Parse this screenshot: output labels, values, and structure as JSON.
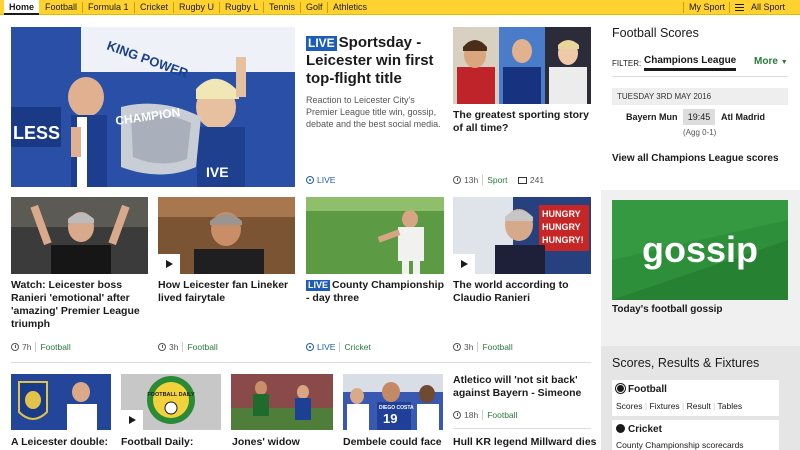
{
  "nav": {
    "items": [
      "Home",
      "Football",
      "Formula 1",
      "Cricket",
      "Rugby U",
      "Rugby L",
      "Tennis",
      "Golf",
      "Athletics"
    ],
    "my_sport": "My Sport",
    "all_sport": "All Sport"
  },
  "hero": {
    "live_badge": "LIVE",
    "title": "Sportsday - Leicester win first top-flight title",
    "summary": "Reaction to Leicester City's Premier League title win, gossip, debate and the best social media.",
    "meta_live": "LIVE"
  },
  "story_greatest": {
    "title": "The greatest sporting story of all time?",
    "time": "13h",
    "tag": "Sport",
    "comments": "241"
  },
  "row2": [
    {
      "title": "Watch: Leicester boss Ranieri 'emotional' after 'amazing' Premier League triumph",
      "time": "7h",
      "tag": "Football"
    },
    {
      "title": "How Leicester fan Lineker lived fairytale",
      "time": "3h",
      "tag": "Football"
    },
    {
      "live_badge": "LIVE",
      "title": "County Championship - day three",
      "time": "LIVE",
      "tag": "Cricket"
    },
    {
      "title": "The world according to Claudio Ranieri",
      "time": "3h",
      "tag": "Football"
    }
  ],
  "row3": [
    {
      "title": "A Leicester double:"
    },
    {
      "title": "Football Daily:"
    },
    {
      "title": "Jones' widow"
    },
    {
      "title": "Dembele could face"
    }
  ],
  "story_atletico": {
    "title": "Atletico will 'not sit back' against Bayern - Simeone",
    "time": "18h",
    "tag": "Football"
  },
  "story_hullkr": {
    "title": "Hull KR legend Millward dies"
  },
  "image_text": {
    "hero_badge": "CHAMPION",
    "hero_banner": "KING POWER",
    "hero_less": "LESS",
    "hero_ive": "IVE",
    "shirt_number": "19",
    "shirt_name": "DIEGO COSTA",
    "hungry_line": "HUNGRY",
    "hungry_last": "HUNGRY!",
    "football_daily": "FOOTBALL DAILY",
    "gossip": "gossip"
  },
  "scores": {
    "title": "Football Scores",
    "filter_label": "FILTER:",
    "filter_value": "Champions League",
    "more": "More",
    "date": "TUESDAY 3RD MAY 2016",
    "home": "Bayern Mun",
    "kickoff": "19:45",
    "away": "Atl Madrid",
    "agg": "(Agg 0-1)",
    "view_all": "View all Champions League scores"
  },
  "gossip": {
    "caption": "Today's football gossip"
  },
  "srf": {
    "title": "Scores, Results & Fixtures",
    "football": {
      "title": "Football",
      "links": [
        "Scores",
        "Fixtures",
        "Result",
        "Tables"
      ]
    },
    "cricket": {
      "title": "Cricket",
      "links": [
        "County Championship scorecards"
      ]
    }
  },
  "colors": {
    "nav_yellow": "#ffd230",
    "live_blue": "#1c5db8",
    "tag_green": "#2a7a3a",
    "gossip_green": "#2a8a36"
  }
}
